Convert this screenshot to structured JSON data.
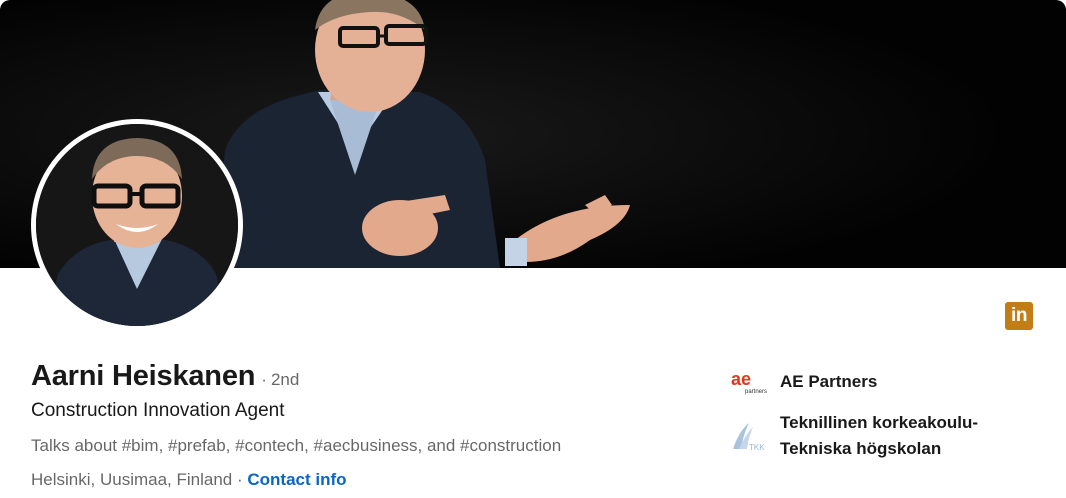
{
  "profile": {
    "name": "Aarni Heiskanen",
    "degree": "2nd",
    "degree_dot": "·",
    "headline": "Construction Innovation Agent",
    "talks_about": "Talks about #bim, #prefab, #contech, #aecbusiness, and #construction",
    "location": "Helsinki, Uusimaa, Finland",
    "location_sep": "·",
    "contact_info": "Contact info"
  },
  "badge": {
    "label": "in",
    "color": "#c37d16"
  },
  "organizations": [
    {
      "name": "AE Partners",
      "logo_text": "ae",
      "logo_subtext": "partners",
      "logo_color": "#e03a1e",
      "icon": "ae-partners-logo"
    },
    {
      "name_line1": "Teknillinen korkeakoulu-",
      "name_line2": "Tekniska högskolan",
      "logo_text": "TKK",
      "logo_color": "#9bb7d4",
      "icon": "tkk-logo"
    }
  ],
  "colors": {
    "link": "#0a66c2",
    "cover_bg": "#050505"
  }
}
